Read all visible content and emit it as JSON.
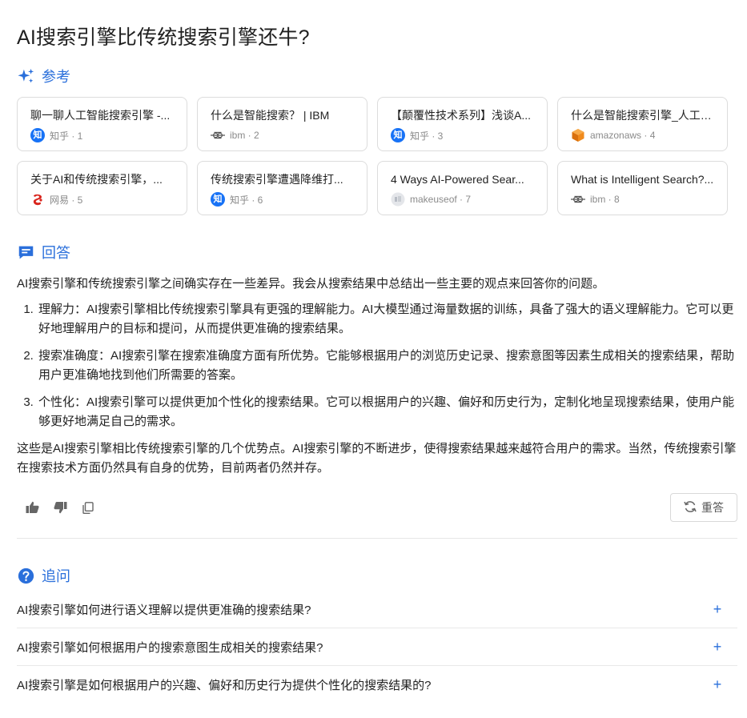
{
  "title": "AI搜索引擎比传统搜索引擎还牛?",
  "references": {
    "heading": "参考",
    "icon": "sparkle-icon",
    "items": [
      {
        "title": "聊一聊人工智能搜索引擎 -...",
        "source": "知乎 · 1",
        "icon": "zhihu-icon"
      },
      {
        "title": "什么是智能搜索？ | IBM",
        "source": "ibm · 2",
        "icon": "ibm-icon"
      },
      {
        "title": "【颠覆性技术系列】浅谈A...",
        "source": "知乎 · 3",
        "icon": "zhihu-icon"
      },
      {
        "title": "什么是智能搜索引擎_人工智...",
        "source": "amazonaws · 4",
        "icon": "aws-cube-icon"
      },
      {
        "title": "关于AI和传统搜索引擎，...",
        "source": "网易 · 5",
        "icon": "netease-icon"
      },
      {
        "title": "传统搜索引擎遭遇降维打...",
        "source": "知乎 · 6",
        "icon": "zhihu-icon"
      },
      {
        "title": "4 Ways AI-Powered Sear...",
        "source": "makeuseof · 7",
        "icon": "makeuseof-icon"
      },
      {
        "title": "What is Intelligent Search?...",
        "source": "ibm · 8",
        "icon": "ibm-icon"
      }
    ]
  },
  "answer": {
    "heading": "回答",
    "icon": "chat-bubble-icon",
    "intro": "AI搜索引擎和传统搜索引擎之间确实存在一些差异。我会从搜索结果中总结出一些主要的观点来回答你的问题。",
    "points": [
      "理解力：AI搜索引擎相比传统搜索引擎具有更强的理解能力。AI大模型通过海量数据的训练，具备了强大的语义理解能力。它可以更好地理解用户的目标和提问，从而提供更准确的搜索结果。",
      "搜索准确度：AI搜索引擎在搜索准确度方面有所优势。它能够根据用户的浏览历史记录、搜索意图等因素生成相关的搜索结果，帮助用户更准确地找到他们所需要的答案。",
      "个性化：AI搜索引擎可以提供更加个性化的搜索结果。它可以根据用户的兴趣、偏好和历史行为，定制化地呈现搜索结果，使用户能够更好地满足自己的需求。"
    ],
    "conclusion": "这些是AI搜索引擎相比传统搜索引擎的几个优势点。AI搜索引擎的不断进步，使得搜索结果越来越符合用户的需求。当然，传统搜索引擎在搜索技术方面仍然具有自身的优势，目前两者仍然并存。"
  },
  "actions": {
    "like_icon": "thumbs-up-icon",
    "dislike_icon": "thumbs-down-icon",
    "copy_icon": "copy-icon",
    "regenerate_label": "重答",
    "regenerate_icon": "refresh-icon"
  },
  "followups": {
    "heading": "追问",
    "icon": "question-circle-icon",
    "items": [
      "AI搜索引擎如何进行语义理解以提供更准确的搜索结果?",
      "AI搜索引擎如何根据用户的搜索意图生成相关的搜索结果?",
      "AI搜索引擎是如何根据用户的兴趣、偏好和历史行为提供个性化的搜索结果的?"
    ],
    "expand_symbol": "+"
  },
  "colors": {
    "accent": "#2a6fdb",
    "zhihu": "#1772f6",
    "aws": "#f08a1c",
    "netease": "#d9251d"
  }
}
